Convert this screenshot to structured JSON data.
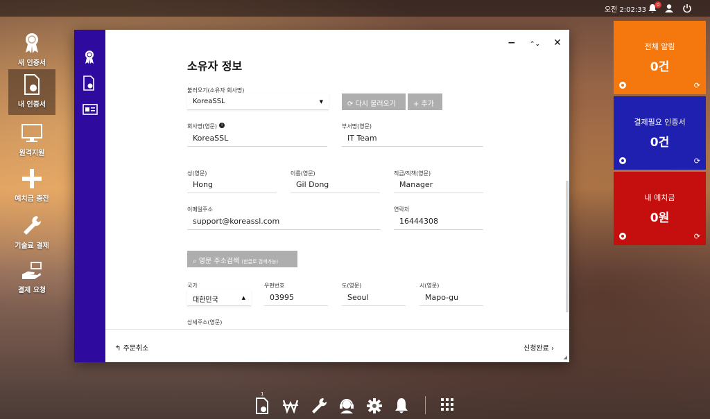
{
  "topbar": {
    "clock": "오전 2:02:33",
    "notification_count": "0"
  },
  "desktop": {
    "icons": [
      {
        "label": "새 인증서",
        "icon": "ribbon-icon"
      },
      {
        "label": "내 인증서",
        "icon": "certificate-icon"
      },
      {
        "label": "원격지원",
        "icon": "monitor-icon"
      },
      {
        "label": "예치금 충전",
        "icon": "plus-icon"
      },
      {
        "label": "기술료 결제",
        "icon": "wrench-icon"
      },
      {
        "label": "결제 요청",
        "icon": "payment-hand-icon"
      }
    ]
  },
  "window": {
    "title": "소유자 정보",
    "controls": {
      "minimize": "−",
      "restore": "⌃⌄",
      "close": "✕"
    },
    "load": {
      "label": "불러오기(소유자 회사명)",
      "selected": "KoreaSSL",
      "reload_button": "다시 불러오기",
      "add_button": "+ 추가"
    },
    "fields": {
      "company_label": "회사명(영문)",
      "company_value": "KoreaSSL",
      "dept_label": "부서명(영문)",
      "dept_value": "IT Team",
      "last_label": "성(영문)",
      "last_value": "Hong",
      "first_label": "이름(영문)",
      "first_value": "Gil Dong",
      "title_label": "직급/직책(영문)",
      "title_value": "Manager",
      "email_label": "이메일주소",
      "email_value": "support@koreassl.com",
      "phone_label": "연락처",
      "phone_value": "16444308",
      "address_search_button": "영문 주소검색",
      "address_search_hint": "(한글로 검색가능)",
      "country_label": "국가",
      "country_value": "대한민국",
      "zip_label": "우편번호",
      "zip_value": "03995",
      "province_label": "도(영문)",
      "province_value": "Seoul",
      "city_label": "시(영문)",
      "city_value": "Mapo-gu",
      "detail_label": "상세주소(영문)"
    },
    "footer": {
      "cancel": "주문취소",
      "done": "신청완료"
    }
  },
  "tiles": [
    {
      "label": "전체 알림",
      "value": "0건",
      "color": "#f5780f"
    },
    {
      "label": "결제필요 인증서",
      "value": "0건",
      "color": "#1f1fb0"
    },
    {
      "label": "내 예치금",
      "value": "0원",
      "color": "#c50e0e"
    }
  ],
  "taskbar": {
    "badge": "1",
    "items": [
      "certificate-icon",
      "won-icon",
      "wrench-icon",
      "headset-icon",
      "gear-icon",
      "bell-icon",
      "apps-grid-icon"
    ]
  }
}
